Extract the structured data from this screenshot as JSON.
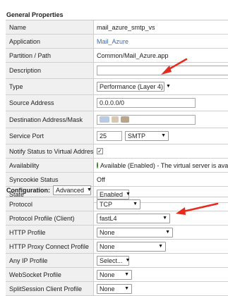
{
  "general": {
    "title": "General Properties",
    "rows": {
      "name": {
        "label": "Name",
        "value": "mail_azure_smtp_vs"
      },
      "application": {
        "label": "Application",
        "value": "Mail_Azure"
      },
      "partition": {
        "label": "Partition / Path",
        "value": "Common/Mail_Azure.app"
      },
      "description": {
        "label": "Description",
        "value": ""
      },
      "type": {
        "label": "Type",
        "value": "Performance (Layer 4)"
      },
      "source": {
        "label": "Source Address",
        "value": "0.0.0.0/0"
      },
      "destination": {
        "label": "Destination Address/Mask",
        "value": ""
      },
      "service_port": {
        "label": "Service Port",
        "value": "25",
        "protocol": "SMTP"
      },
      "notify": {
        "label": "Notify Status to Virtual Address",
        "checked": true
      },
      "availability": {
        "label": "Availability",
        "value": "Available (Enabled) - The virtual server is availabl"
      },
      "syncookie": {
        "label": "Syncookie Status",
        "value": "Off"
      },
      "state": {
        "label": "State",
        "value": "Enabled"
      }
    }
  },
  "configuration": {
    "title": "Configuration:",
    "mode": "Advanced",
    "rows": {
      "protocol": {
        "label": "Protocol",
        "value": "TCP"
      },
      "protocol_profile": {
        "label": "Protocol Profile (Client)",
        "value": "fastL4"
      },
      "http_profile": {
        "label": "HTTP Profile",
        "value": "None"
      },
      "http_proxy": {
        "label": "HTTP Proxy Connect Profile",
        "value": "None"
      },
      "any_ip": {
        "label": "Any IP Profile",
        "value": "Select..."
      },
      "websocket": {
        "label": "WebSocket Profile",
        "value": "None"
      },
      "splitsession": {
        "label": "SplitSession Client Profile",
        "value": "None"
      }
    }
  },
  "colors": {
    "annotation_arrow": "#e8291c",
    "link": "#3a6bb8"
  }
}
